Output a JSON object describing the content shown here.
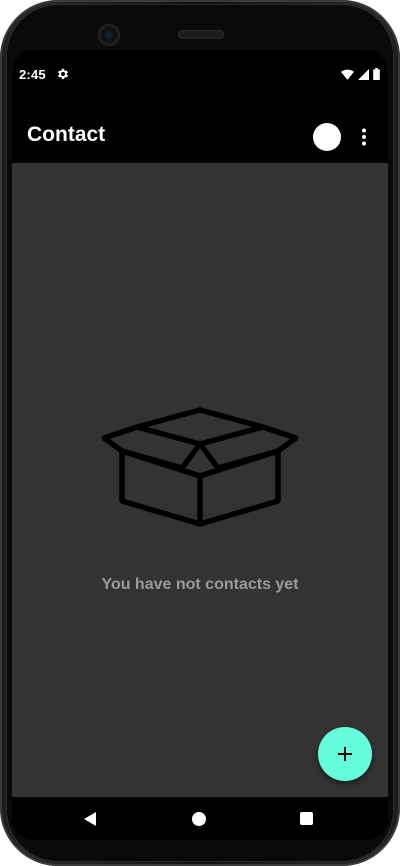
{
  "status_bar": {
    "time": "2:45",
    "settings_icon": "gear-icon",
    "wifi_icon": "wifi-icon",
    "signal_icon": "cell-signal-icon",
    "battery_icon": "battery-icon"
  },
  "app_bar": {
    "title": "Contact",
    "avatar_icon": "profile-avatar",
    "menu_icon": "more-vert-icon"
  },
  "empty_state": {
    "icon": "open-box-icon",
    "message": "You have not contacts yet"
  },
  "fab": {
    "icon": "plus-icon",
    "color": "#64ffda"
  },
  "nav_bar": {
    "back_icon": "back-triangle-icon",
    "home_icon": "home-circle-icon",
    "recents_icon": "recents-square-icon"
  },
  "colors": {
    "app_bar_bg": "#000000",
    "content_bg": "#333333",
    "empty_text": "#9a9a9a",
    "accent": "#64ffda"
  }
}
